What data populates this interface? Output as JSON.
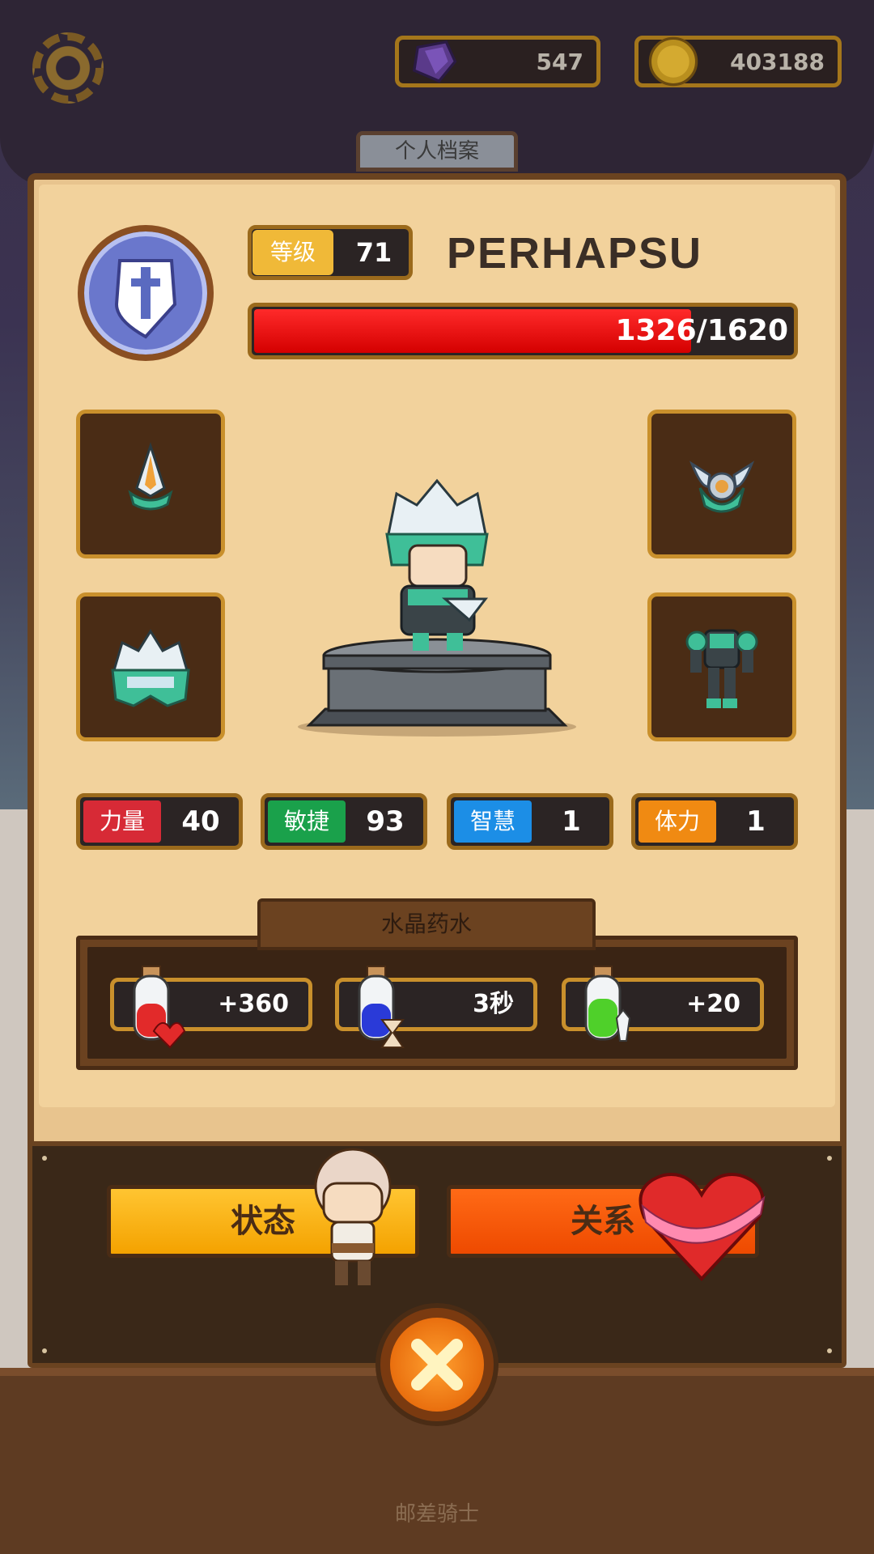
{
  "currencies": {
    "gems": "547",
    "coins": "403188"
  },
  "profile_tab_label": "个人档案",
  "player": {
    "level_label": "等级",
    "level": "71",
    "name": "PERHAPSU",
    "hp_text": "1326/1620",
    "hp_current": 1326,
    "hp_max": 1620
  },
  "equipment_slots": [
    {
      "name": "weapon",
      "icon": "dagger-icon"
    },
    {
      "name": "amulet",
      "icon": "winged-amulet-icon"
    },
    {
      "name": "helmet",
      "icon": "crystal-helmet-icon"
    },
    {
      "name": "armor",
      "icon": "armor-suit-icon"
    }
  ],
  "stats": [
    {
      "label": "力量",
      "value": "40",
      "color": "#d72a36"
    },
    {
      "label": "敏捷",
      "value": "93",
      "color": "#1aa14b"
    },
    {
      "label": "智慧",
      "value": "1",
      "color": "#1c8ee6"
    },
    {
      "label": "体力",
      "value": "1",
      "color": "#f08a12"
    }
  ],
  "potions": {
    "title": "水晶药水",
    "items": [
      {
        "icon": "health-potion-icon",
        "value": "+360"
      },
      {
        "icon": "time-potion-icon",
        "value": "3秒"
      },
      {
        "icon": "attack-potion-icon",
        "value": "+20"
      }
    ]
  },
  "actions": {
    "status_label": "状态",
    "relation_label": "关系"
  },
  "footer_caption": "邮差骑士"
}
